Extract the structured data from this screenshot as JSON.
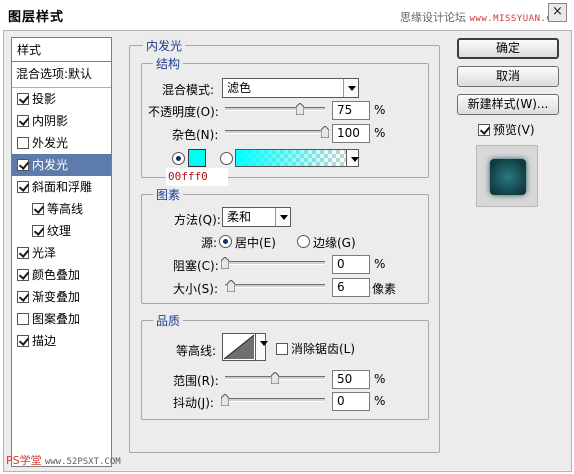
{
  "window": {
    "title": "图层样式",
    "watermark_cn": "思缘设计论坛",
    "watermark_site": "www.MISSYUAN.COM",
    "close": "×"
  },
  "sidebar": {
    "header": "样式",
    "blend": "混合选项:默认",
    "items": [
      {
        "label": "投影",
        "checked": true
      },
      {
        "label": "内阴影",
        "checked": true
      },
      {
        "label": "外发光",
        "checked": false
      },
      {
        "label": "内发光",
        "checked": true,
        "selected": true
      },
      {
        "label": "斜面和浮雕",
        "checked": true
      },
      {
        "label": "等高线",
        "checked": true,
        "indent": true
      },
      {
        "label": "纹理",
        "checked": true,
        "indent": true
      },
      {
        "label": "光泽",
        "checked": true
      },
      {
        "label": "颜色叠加",
        "checked": true
      },
      {
        "label": "渐变叠加",
        "checked": true
      },
      {
        "label": "图案叠加",
        "checked": false
      },
      {
        "label": "描边",
        "checked": true
      }
    ]
  },
  "panel": {
    "title": "内发光",
    "structure": {
      "title": "结构",
      "blend_mode_label": "混合模式:",
      "blend_mode_value": "滤色",
      "opacity_label": "不透明度(O):",
      "opacity_value": "75",
      "opacity_unit": "%",
      "opacity_level": 0.75,
      "noise_label": "杂色(N):",
      "noise_value": "100",
      "noise_unit": "%",
      "noise_level": 1.0,
      "color_hex": "00fff0",
      "color_swatch": "#00fff0"
    },
    "elements": {
      "title": "图素",
      "method_label": "方法(Q):",
      "method_value": "柔和",
      "source_label": "源:",
      "source_center": "居中(E)",
      "source_edge": "边缘(G)",
      "choke_label": "阻塞(C):",
      "choke_value": "0",
      "choke_unit": "%",
      "choke_level": 0.0,
      "size_label": "大小(S):",
      "size_value": "6",
      "size_unit": "像素",
      "size_level": 0.06
    },
    "quality": {
      "title": "品质",
      "contour_label": "等高线:",
      "antialias_label": "消除锯齿(L)",
      "antialias_checked": false,
      "range_label": "范围(R):",
      "range_value": "50",
      "range_unit": "%",
      "range_level": 0.5,
      "jitter_label": "抖动(J):",
      "jitter_value": "0",
      "jitter_unit": "%",
      "jitter_level": 0.0
    }
  },
  "buttons": {
    "ok": "确定",
    "cancel": "取消",
    "new_style": "新建样式(W)...",
    "preview_label": "预览(V)",
    "preview_checked": true
  },
  "footer_watermark": {
    "brand": "PS学堂",
    "site": "www.52PSXT.COM"
  },
  "colors": {
    "accent_selected": "#5d7bab",
    "glow": "#00fff0",
    "label_blue": "#1b3f8f"
  }
}
